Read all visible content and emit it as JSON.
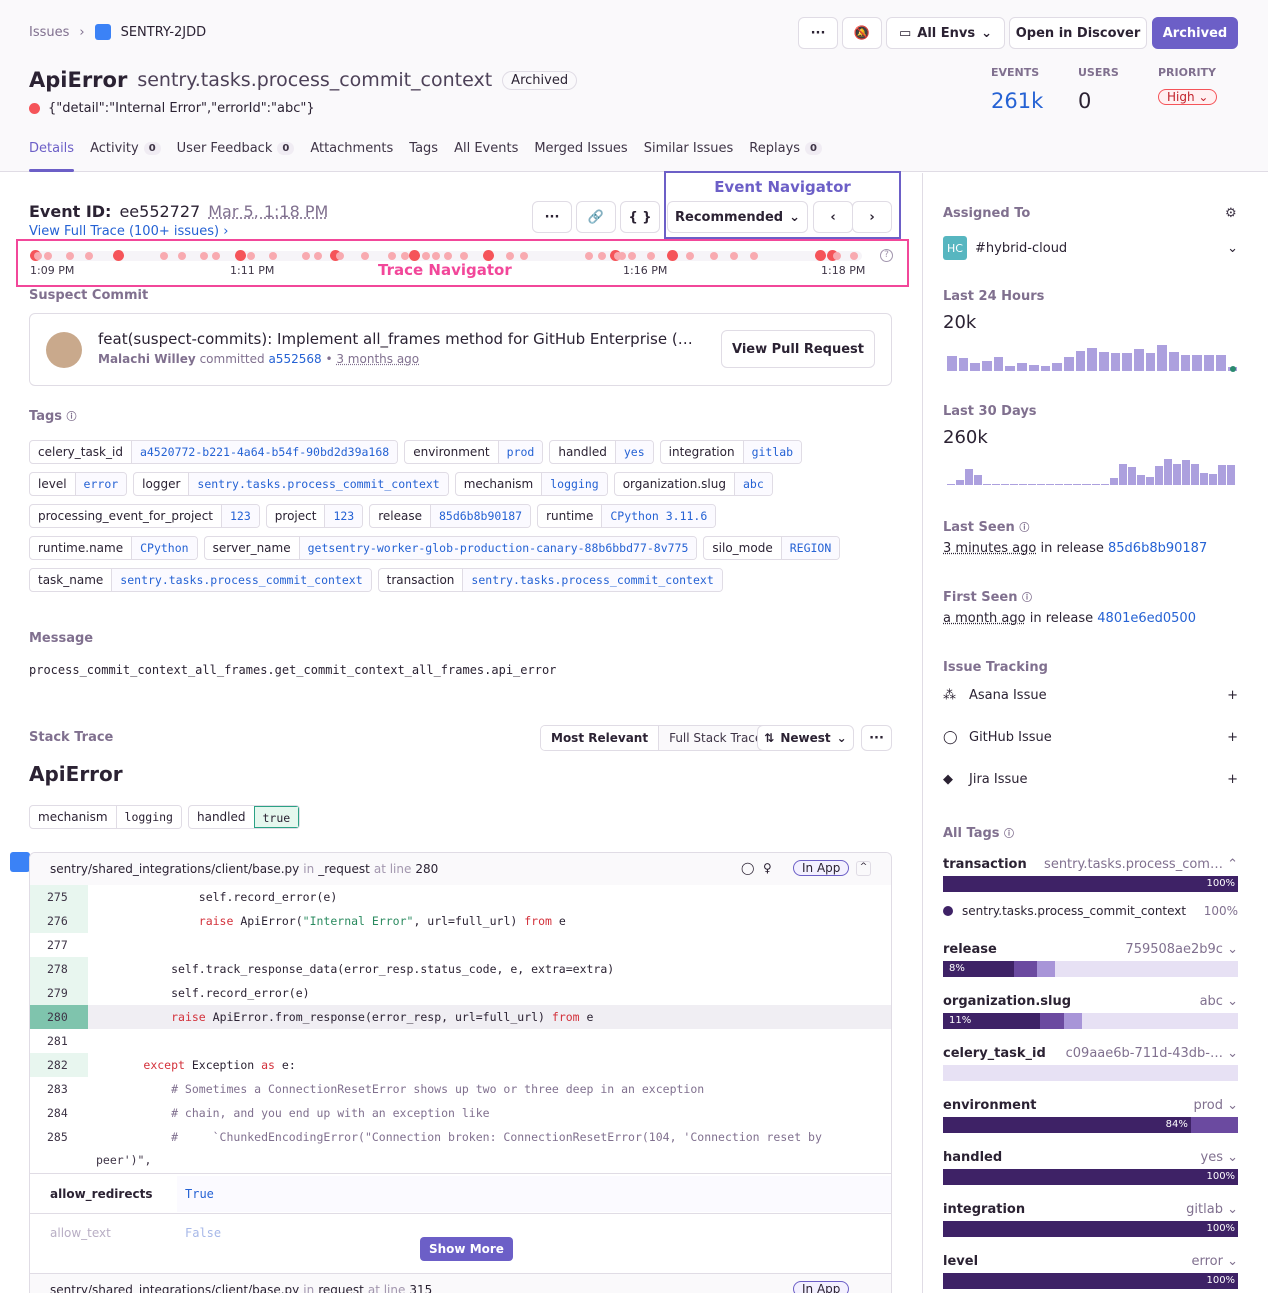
{
  "breadcrumb": {
    "root": "Issues",
    "current": "SENTRY-2JDD"
  },
  "header": {
    "title": "ApiError",
    "culprit": "sentry.tasks.process_commit_context",
    "status_badge": "Archived",
    "message": "{\"detail\":\"Internal Error\",\"errorId\":\"abc\"}",
    "actions": {
      "more": "···",
      "env": "All Envs",
      "discover": "Open in Discover",
      "archived": "Archived"
    },
    "stats": {
      "events_label": "EVENTS",
      "events": "261k",
      "users_label": "USERS",
      "users": "0",
      "priority_label": "PRIORITY",
      "priority": "High"
    }
  },
  "tabs": [
    {
      "label": "Details",
      "active": true
    },
    {
      "label": "Activity",
      "count": "0"
    },
    {
      "label": "User Feedback",
      "count": "0"
    },
    {
      "label": "Attachments"
    },
    {
      "label": "Tags"
    },
    {
      "label": "All Events"
    },
    {
      "label": "Merged Issues"
    },
    {
      "label": "Similar Issues"
    },
    {
      "label": "Replays",
      "count": "0"
    }
  ],
  "event": {
    "id_label": "Event ID:",
    "id": "ee552727",
    "date": "Mar 5, 1:18 PM",
    "trace_link": "View Full Trace (100+ issues)",
    "navigator_label": "Event Navigator",
    "recommended": "Recommended",
    "trace_navigator_label": "Trace Navigator",
    "trace_times": [
      "1:09 PM",
      "1:11 PM",
      "1:16 PM",
      "1:18 PM"
    ]
  },
  "suspect": {
    "title": "Suspect Commit",
    "message": "feat(suspect-commits): Implement all_frames method for GitHub Enterprise (…",
    "author": "Malachi Willey",
    "committed": "committed",
    "sha": "a552568",
    "sep": "•",
    "when": "3 months ago",
    "button": "View Pull Request"
  },
  "tags": {
    "title": "Tags",
    "items": [
      [
        "celery_task_id",
        "a4520772-b221-4a64-b54f-90bd2d39a168"
      ],
      [
        "environment",
        "prod"
      ],
      [
        "handled",
        "yes"
      ],
      [
        "integration",
        "gitlab"
      ],
      [
        "level",
        "error"
      ],
      [
        "logger",
        "sentry.tasks.process_commit_context"
      ],
      [
        "mechanism",
        "logging"
      ],
      [
        "organization.slug",
        "abc"
      ],
      [
        "processing_event_for_project",
        "123"
      ],
      [
        "project",
        "123"
      ],
      [
        "release",
        "85d6b8b90187"
      ],
      [
        "runtime",
        "CPython 3.11.6"
      ],
      [
        "runtime.name",
        "CPython"
      ],
      [
        "server_name",
        "getsentry-worker-glob-production-canary-88b6bbd77-8v775"
      ],
      [
        "silo_mode",
        "REGION"
      ],
      [
        "task_name",
        "sentry.tasks.process_commit_context"
      ],
      [
        "transaction",
        "sentry.tasks.process_commit_context"
      ]
    ]
  },
  "message": {
    "title": "Message",
    "text": "process_commit_context_all_frames.get_commit_context_all_frames.api_error"
  },
  "stack": {
    "title": "Stack Trace",
    "most_relevant": "Most Relevant",
    "full": "Full Stack Trace",
    "sort": "Newest",
    "exception": "ApiError",
    "mech": [
      [
        "mechanism",
        "logging"
      ],
      [
        "handled",
        "true"
      ]
    ],
    "frame": {
      "file": "sentry/shared_integrations/client/base.py",
      "in": "in",
      "func": "_request",
      "at": "at line",
      "line": "280",
      "in_app": "In App"
    },
    "code": [
      {
        "n": "275",
        "parts": [
          [
            "",
            "                self.record_error(e)"
          ]
        ],
        "hl": true
      },
      {
        "n": "276",
        "parts": [
          [
            "",
            "                "
          ],
          [
            "kw",
            "raise"
          ],
          [
            "",
            " ApiError("
          ],
          [
            "str",
            "\"Internal Error\""
          ],
          [
            "",
            ", url=full_url) "
          ],
          [
            "kw",
            "from"
          ],
          [
            "",
            " e"
          ]
        ],
        "hl": true
      },
      {
        "n": "277",
        "parts": [
          [
            "",
            ""
          ]
        ]
      },
      {
        "n": "278",
        "parts": [
          [
            "",
            "            self.track_response_data(error_resp.status_code, e, extra=extra)"
          ]
        ],
        "hl": true
      },
      {
        "n": "279",
        "parts": [
          [
            "",
            "            self.record_error(e)"
          ]
        ],
        "hl": true
      },
      {
        "n": "280",
        "parts": [
          [
            "",
            "            "
          ],
          [
            "kw",
            "raise"
          ],
          [
            "",
            " ApiError.from_response(error_resp, url=full_url) "
          ],
          [
            "kw",
            "from"
          ],
          [
            "",
            " e"
          ]
        ],
        "active": true
      },
      {
        "n": "281",
        "parts": [
          [
            "",
            ""
          ]
        ]
      },
      {
        "n": "282",
        "parts": [
          [
            "",
            "        "
          ],
          [
            "kw",
            "except"
          ],
          [
            "",
            " Exception "
          ],
          [
            "kw",
            "as"
          ],
          [
            "",
            " e:"
          ]
        ],
        "hl": true
      },
      {
        "n": "283",
        "parts": [
          [
            "cm",
            "            # Sometimes a ConnectionResetError shows up two or three deep in an exception"
          ]
        ]
      },
      {
        "n": "284",
        "parts": [
          [
            "cm",
            "            # chain, and you end up with an exception like"
          ]
        ]
      },
      {
        "n": "285",
        "parts": [
          [
            "cm",
            "            #     `ChunkedEncodingError(\"Connection broken: ConnectionResetError(104, 'Connection reset by"
          ]
        ]
      }
    ],
    "wrap": "peer')\",",
    "vars": [
      [
        "allow_redirects",
        "True"
      ],
      [
        "allow_text",
        "False"
      ]
    ],
    "show_more": "Show More",
    "next_frame": {
      "file": "sentry/shared_integrations/client/base.py",
      "in": "in",
      "func": "request",
      "at": "at line",
      "line": "315",
      "in_app": "In App"
    }
  },
  "sidebar": {
    "assigned_label": "Assigned To",
    "assignee_initials": "HC",
    "assignee": "#hybrid-cloud",
    "last24_label": "Last 24 Hours",
    "last24": "20k",
    "last24_bars": [
      45,
      40,
      24,
      30,
      42,
      15,
      25,
      18,
      16,
      25,
      42,
      62,
      72,
      58,
      55,
      55,
      68,
      55,
      80,
      58,
      50,
      48,
      48,
      50,
      12
    ],
    "last30_label": "Last 30 Days",
    "last30": "260k",
    "last30_bars": [
      2,
      14,
      48,
      30,
      2,
      2,
      2,
      2,
      2,
      2,
      2,
      2,
      2,
      2,
      2,
      2,
      2,
      2,
      22,
      64,
      56,
      30,
      26,
      60,
      80,
      66,
      76,
      66,
      38,
      34,
      62,
      62
    ],
    "last_seen_label": "Last Seen",
    "last_seen": "3 minutes ago",
    "last_seen_in": "in release",
    "last_seen_release": "85d6b8b90187",
    "first_seen_label": "First Seen",
    "first_seen": "a month ago",
    "first_seen_in": "in release",
    "first_seen_release": "4801e6ed0500",
    "tracking_label": "Issue Tracking",
    "tracking": [
      "Asana Issue",
      "GitHub Issue",
      "Jira Issue"
    ],
    "all_tags_label": "All Tags",
    "tag_dist": [
      {
        "key": "transaction",
        "value": "sentry.tasks.process_com…",
        "pct": 100,
        "label": "100%",
        "detail": "sentry.tasks.process_commit_context",
        "detail_pct": "100%"
      },
      {
        "key": "release",
        "value": "759508ae2b9c",
        "pct": 8,
        "label": "8%"
      },
      {
        "key": "organization.slug",
        "value": "abc",
        "pct": 11,
        "label": "11%"
      },
      {
        "key": "celery_task_id",
        "value": "c09aae6b-711d-43db-…",
        "pct": 0,
        "label": ""
      },
      {
        "key": "environment",
        "value": "prod",
        "pct": 84,
        "label": "84%"
      },
      {
        "key": "handled",
        "value": "yes",
        "pct": 100,
        "label": "100%"
      },
      {
        "key": "integration",
        "value": "gitlab",
        "pct": 100,
        "label": "100%"
      },
      {
        "key": "level",
        "value": "error",
        "pct": 100,
        "label": "100%"
      }
    ]
  },
  "colors": {
    "accent": "#6c5fc7",
    "error": "#f55459",
    "annotation_pink": "#f2479a",
    "bar": "#3e2266",
    "spark": "#aca0de"
  }
}
